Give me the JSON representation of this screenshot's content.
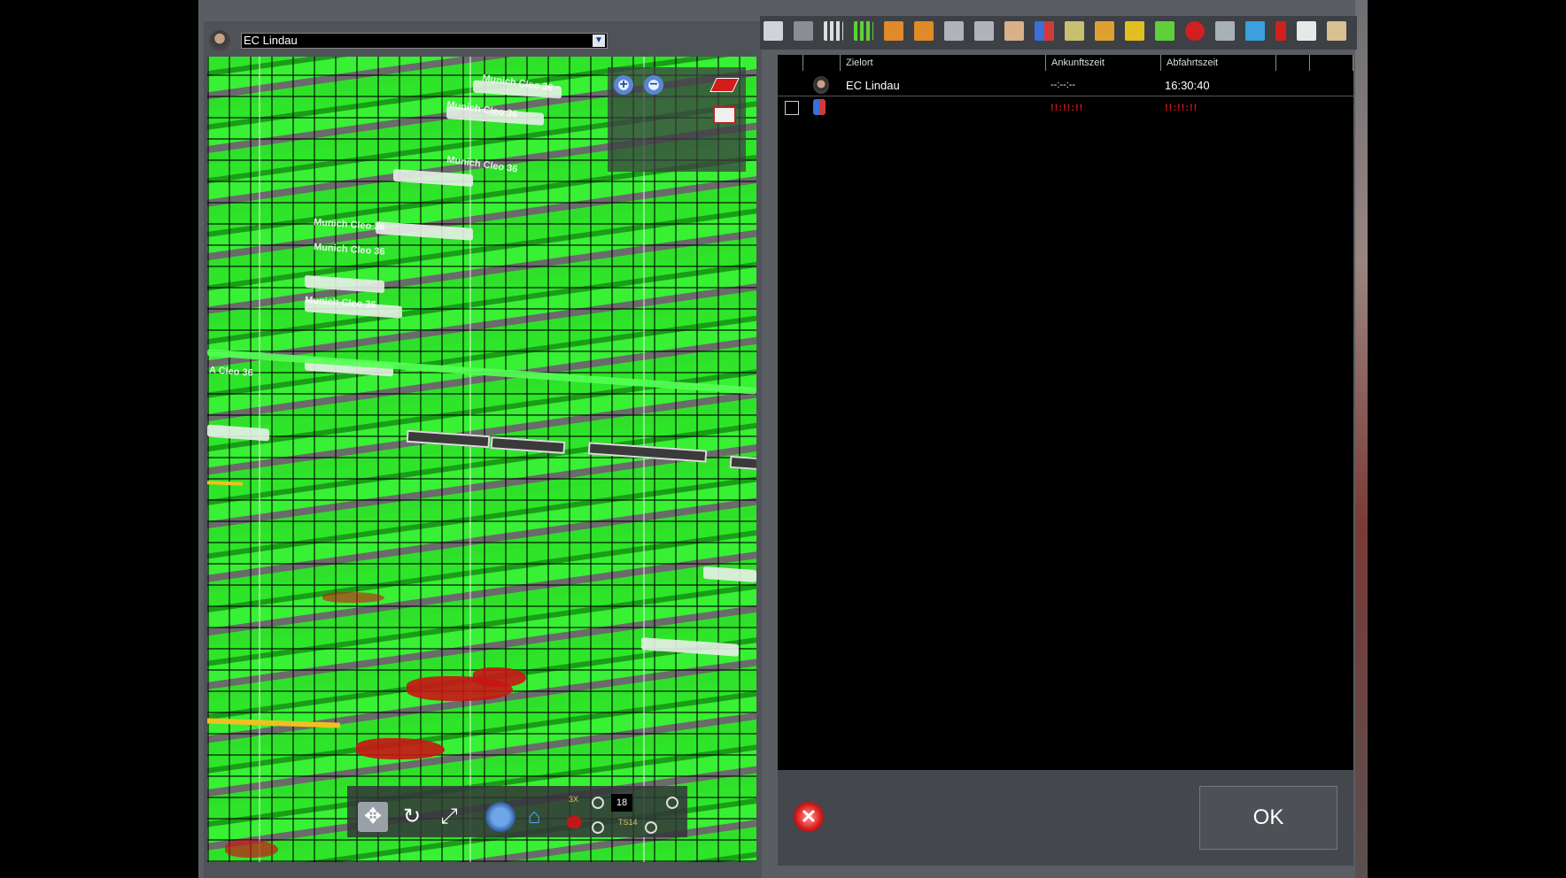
{
  "train_selector": {
    "value": "EC Lindau"
  },
  "map": {
    "ghost_labels": [
      "Munich Cleo 36",
      "Munich Cleo 36",
      "Munich Cleo 36",
      "Munich Cleo 36",
      "Munich Cleo 36",
      "Munich Cleo 36",
      "A Cleo 36"
    ],
    "speed_value": "18",
    "tiny_labels": [
      "3X",
      "TS14"
    ]
  },
  "table": {
    "headers": [
      "",
      "Zielort",
      "Ankunftszeit",
      "Abfahrtszeit",
      "",
      ""
    ],
    "rows": [
      {
        "zielort": "EC Lindau",
        "ankunft": "--:--:--",
        "abfahrt": "16:30:40"
      },
      {
        "zielort": "",
        "ankunft": "!!:!!:!!",
        "abfahrt": "!!:!!:!!"
      }
    ]
  },
  "buttons": {
    "ok_label": "OK"
  },
  "icons": {
    "toolbar": [
      "save-icon",
      "delete-icon",
      "grid-icon",
      "grid-green-icon",
      "move-up-icon",
      "move-down-icon",
      "split-icon",
      "join-icon",
      "hand-icon",
      "passenger-icon",
      "edit-icon",
      "network-icon",
      "add-arrow-icon",
      "add-icon",
      "remove-icon",
      "settings-icon",
      "transfer-icon",
      "flag-icon",
      "wagon-icon",
      "car-icon"
    ]
  },
  "colors": {
    "accent_green": "#2ee52a",
    "error_red": "#d01818"
  }
}
